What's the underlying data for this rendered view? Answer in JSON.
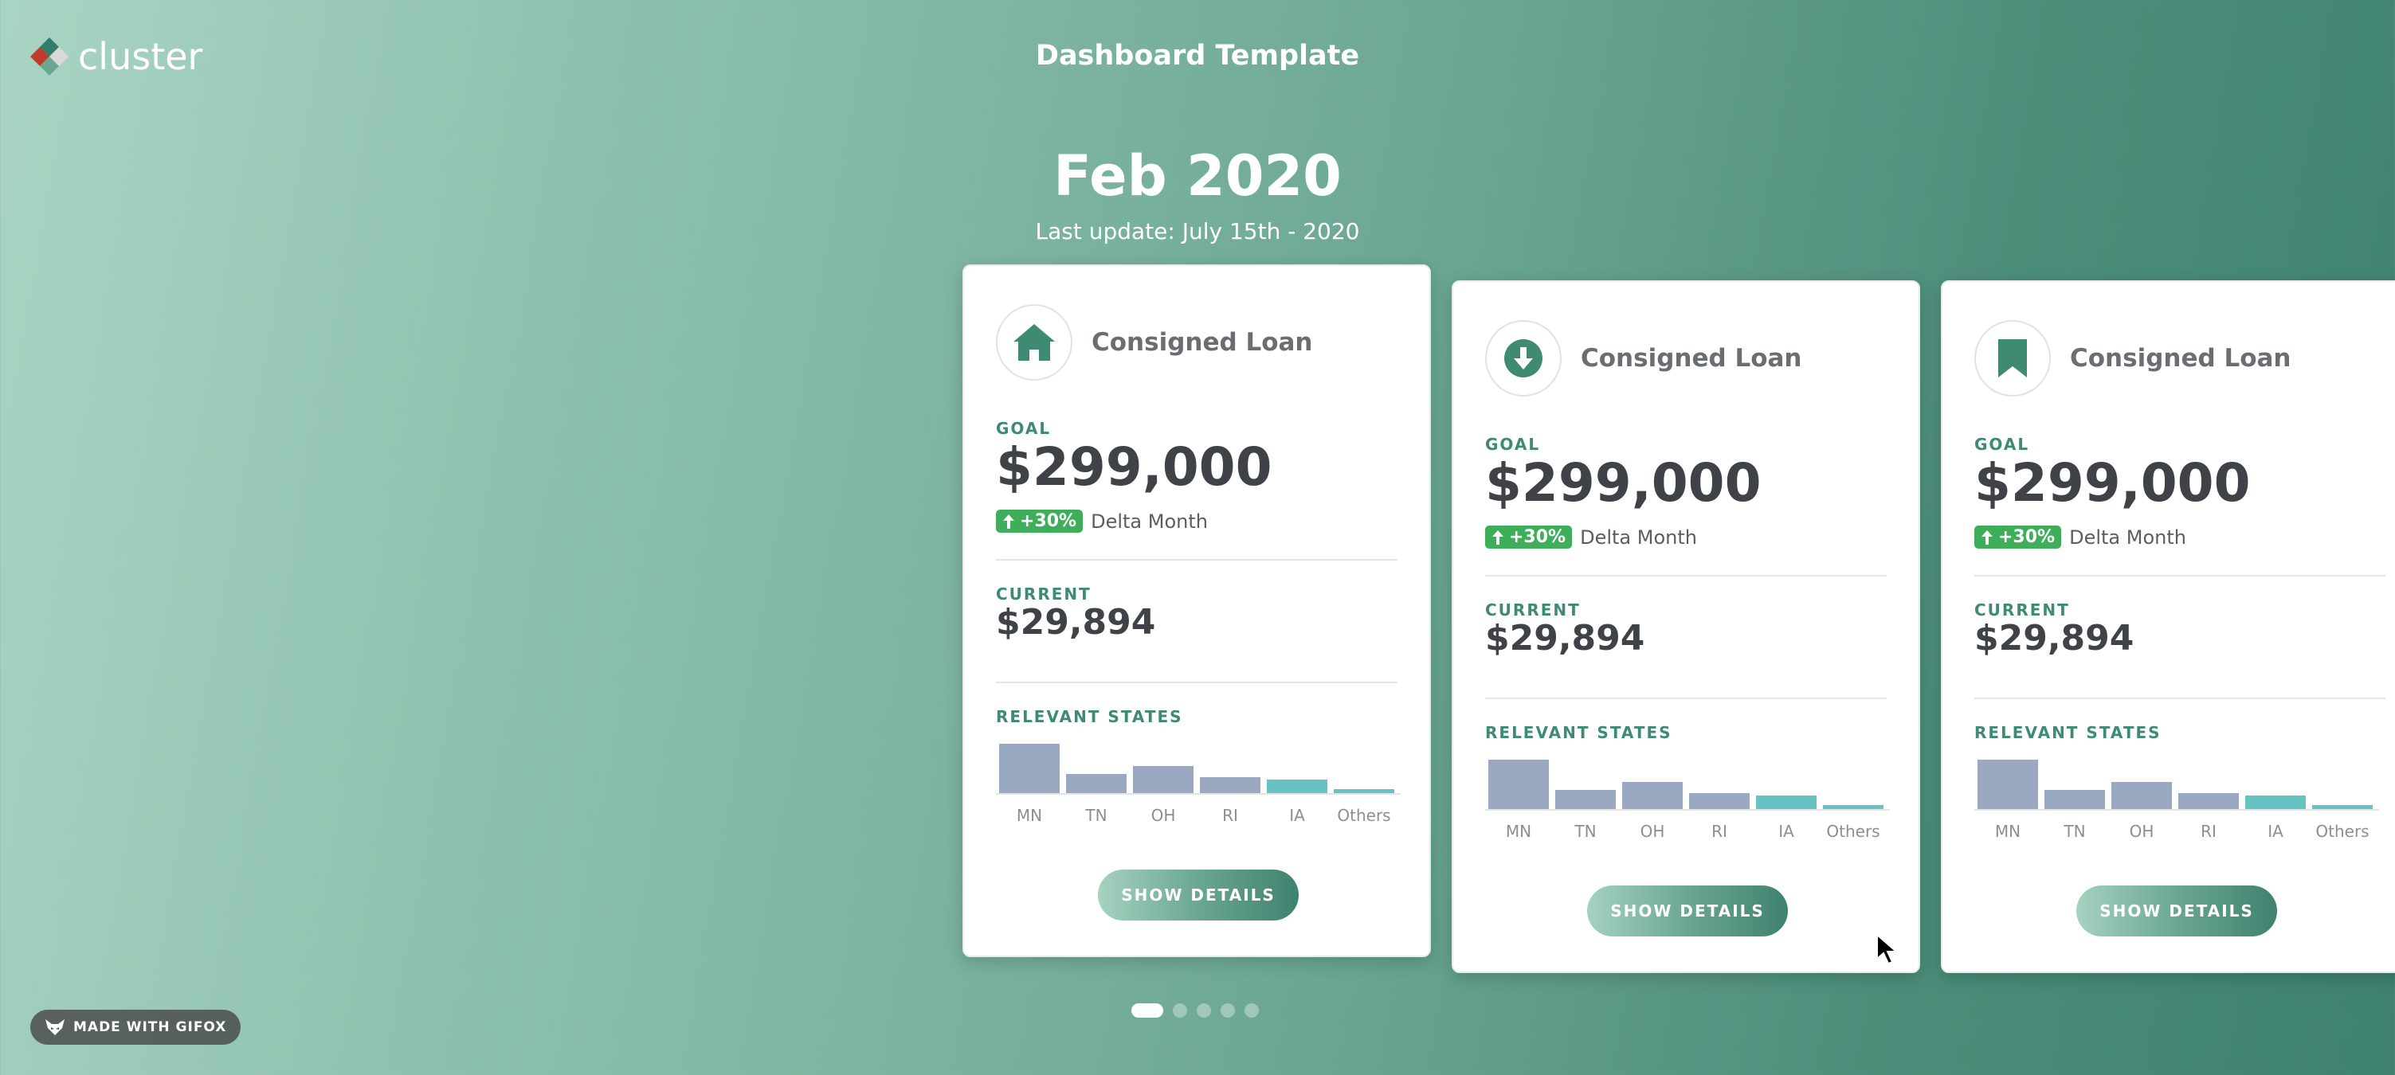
{
  "brand": {
    "logo_text": "cluster"
  },
  "app_title": "Dashboard Template",
  "period": {
    "month": "Feb 2020",
    "last_update": "Last update: July 15th - 2020"
  },
  "colors": {
    "accent": "#3e8a73",
    "badge": "#3fae5a",
    "bar_primary": "#9aa8c2",
    "bar_highlight": "#67c3c3"
  },
  "cards": [
    {
      "icon": "home-icon",
      "title": "Consigned Loan",
      "goal_label": "GOAL",
      "goal_value": "$299,000",
      "delta_value": "+30%",
      "delta_label": "Delta Month",
      "current_label": "CURRENT",
      "current_value": "$29,894",
      "states_label": "RELEVANT STATES",
      "button_label": "SHOW DETAILS"
    },
    {
      "icon": "download-circle-icon",
      "title": "Consigned Loan",
      "goal_label": "GOAL",
      "goal_value": "$299,000",
      "delta_value": "+30%",
      "delta_label": "Delta Month",
      "current_label": "CURRENT",
      "current_value": "$29,894",
      "states_label": "RELEVANT STATES",
      "button_label": "SHOW DETAILS"
    },
    {
      "icon": "bookmark-icon",
      "title": "Consigned Loan",
      "goal_label": "GOAL",
      "goal_value": "$299,000",
      "delta_value": "+30%",
      "delta_label": "Delta Month",
      "current_label": "CURRENT",
      "current_value": "$29,894",
      "states_label": "RELEVANT STATES",
      "button_label": "SHOW DETAILS"
    }
  ],
  "chart_data": {
    "type": "bar",
    "categories": [
      "MN",
      "TN",
      "OH",
      "RI",
      "IA",
      "Others"
    ],
    "values": [
      100,
      38,
      55,
      33,
      27,
      8
    ],
    "highlight": [
      "IA",
      "Others"
    ]
  },
  "pagination": {
    "pages": 5,
    "active": 1
  },
  "watermark": "MADE WITH GIFOX"
}
